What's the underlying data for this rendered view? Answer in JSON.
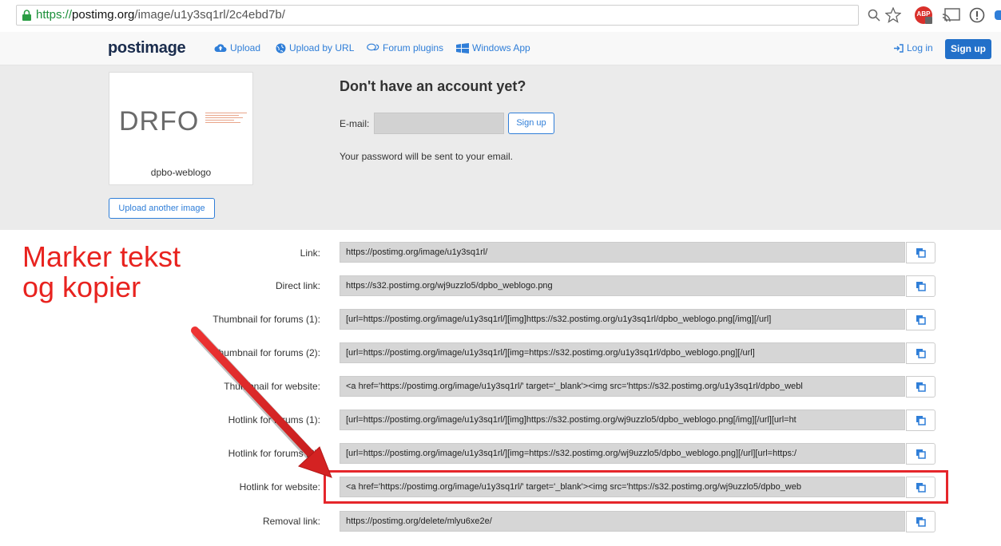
{
  "browser": {
    "url_scheme": "https://",
    "url_host": "postimg.org",
    "url_path": "/image/u1y3sq1rl/2c4ebd7b/",
    "extension_badge": "ABP"
  },
  "nav": {
    "logo": "postimage",
    "upload": "Upload",
    "upload_by_url": "Upload by URL",
    "forum_plugins": "Forum plugins",
    "windows_app": "Windows App",
    "login": "Log in",
    "signup": "Sign up"
  },
  "hero": {
    "thumb_logo": "DRFO",
    "thumb_name": "dpbo-weblogo",
    "upload_another": "Upload another image",
    "title": "Don't have an account yet?",
    "email_label": "E-mail:",
    "email_value": "",
    "signup_button": "Sign up",
    "password_note": "Your password will be sent to your email."
  },
  "links": [
    {
      "label": "Link:",
      "value": "https://postimg.org/image/u1y3sq1rl/"
    },
    {
      "label": "Direct link:",
      "value": "https://s32.postimg.org/wj9uzzlo5/dpbo_weblogo.png"
    },
    {
      "label": "Thumbnail for forums (1):",
      "value": "[url=https://postimg.org/image/u1y3sq1rl/][img]https://s32.postimg.org/u1y3sq1rl/dpbo_weblogo.png[/img][/url]"
    },
    {
      "label": "Thumbnail for forums (2):",
      "value": "[url=https://postimg.org/image/u1y3sq1rl/][img=https://s32.postimg.org/u1y3sq1rl/dpbo_weblogo.png][/url]"
    },
    {
      "label": "Thumbnail for website:",
      "value": "<a href='https://postimg.org/image/u1y3sq1rl/' target='_blank'><img src='https://s32.postimg.org/u1y3sq1rl/dpbo_webl"
    },
    {
      "label": "Hotlink for forums (1):",
      "value": "[url=https://postimg.org/image/u1y3sq1rl/][img]https://s32.postimg.org/wj9uzzlo5/dpbo_weblogo.png[/img][/url][url=ht"
    },
    {
      "label": "Hotlink for forums (2):",
      "value": "[url=https://postimg.org/image/u1y3sq1rl/][img=https://s32.postimg.org/wj9uzzlo5/dpbo_weblogo.png][/url][url=https:/"
    },
    {
      "label": "Hotlink for website:",
      "value": "<a href='https://postimg.org/image/u1y3sq1rl/' target='_blank'><img src='https://s32.postimg.org/wj9uzzlo5/dpbo_web"
    },
    {
      "label": "Removal link:",
      "value": "https://postimg.org/delete/mlyu6xe2e/"
    }
  ],
  "annotation": {
    "line1": "Marker tekst",
    "line2": "og kopier",
    "color": "#e8231f"
  },
  "colors": {
    "accent": "#2f7ed8",
    "primary_button": "#2270c9"
  }
}
